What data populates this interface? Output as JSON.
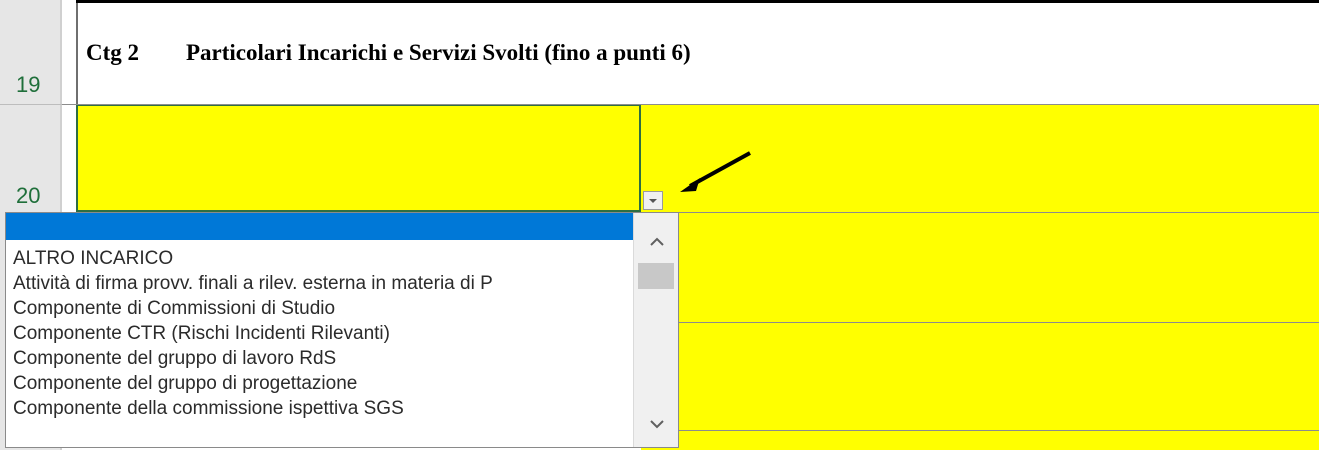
{
  "rows": {
    "row19": "19",
    "row20": "20"
  },
  "header": {
    "ctg": "Ctg 2",
    "title": "Particolari Incarichi e Servizi Svolti (fino a punti 6)"
  },
  "dropdown": {
    "selected": "",
    "items": [
      "ALTRO INCARICO",
      "Attività di firma provv. finali a rilev. esterna in materia di P",
      "Componente  di Commissioni di Studio",
      "Componente CTR (Rischi Incidenti Rilevanti)",
      "Componente del gruppo di lavoro RdS",
      "Componente del gruppo di progettazione",
      "Componente della commissione ispettiva SGS"
    ]
  },
  "colors": {
    "highlight": "#ffff00",
    "selection": "#0078d7",
    "row_number": "#1f6f3a"
  },
  "icons": [
    "chevron-up-icon",
    "chevron-down-icon",
    "dropdown-arrow-icon",
    "pointer-arrow-icon"
  ]
}
